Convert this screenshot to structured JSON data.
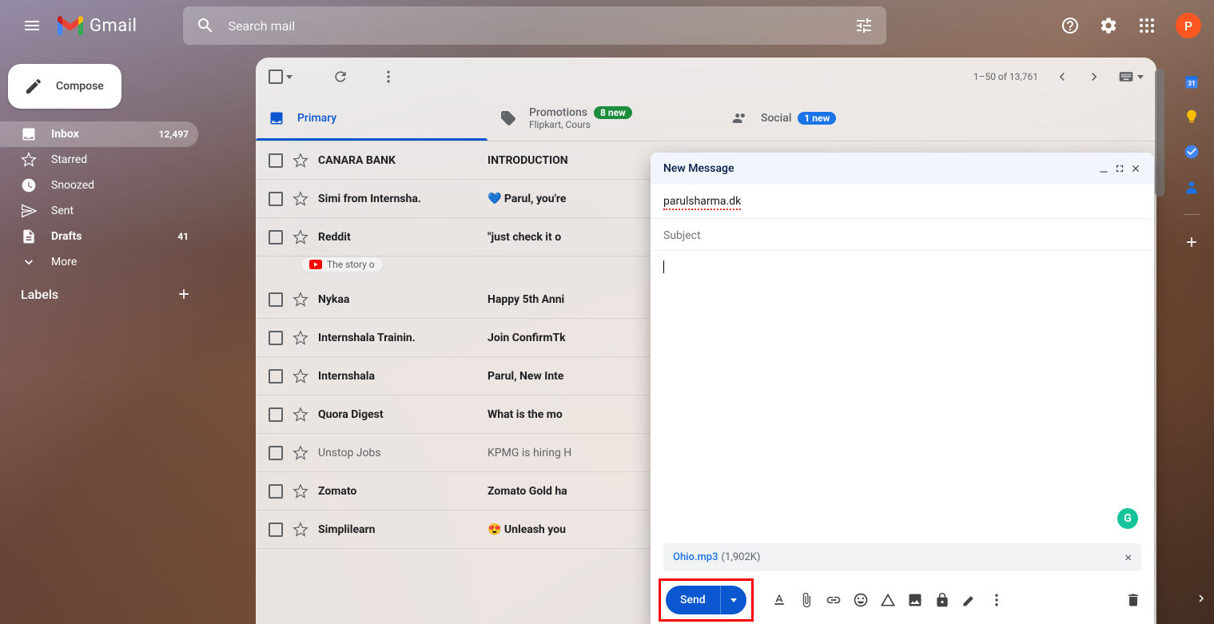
{
  "header": {
    "app_name": "Gmail",
    "search_placeholder": "Search mail",
    "avatar_letter": "P"
  },
  "sidebar": {
    "compose_label": "Compose",
    "items": [
      {
        "label": "Inbox",
        "count": "12,497",
        "active": true,
        "bold": true
      },
      {
        "label": "Starred",
        "count": "",
        "active": false,
        "bold": false
      },
      {
        "label": "Snoozed",
        "count": "",
        "active": false,
        "bold": false
      },
      {
        "label": "Sent",
        "count": "",
        "active": false,
        "bold": false
      },
      {
        "label": "Drafts",
        "count": "41",
        "active": false,
        "bold": true
      },
      {
        "label": "More",
        "count": "",
        "active": false,
        "bold": false
      }
    ],
    "labels_header": "Labels"
  },
  "toolbar": {
    "page_info": "1–50 of 13,761"
  },
  "tabs": [
    {
      "label": "Primary",
      "badge": "",
      "sub": ""
    },
    {
      "label": "Promotions",
      "badge": "8 new",
      "sub": "Flipkart, Cours"
    },
    {
      "label": "Social",
      "badge": "1 new",
      "sub": ""
    }
  ],
  "emails": [
    {
      "sender": "CANARA BANK",
      "subject": "INTRODUCTION",
      "read": false
    },
    {
      "sender": "Simi from Internsha.",
      "subject": "💙 Parul, you're",
      "read": false
    },
    {
      "sender": "Reddit",
      "subject": "\"just check it o",
      "read": false,
      "attachment": "The story o"
    },
    {
      "sender": "Nykaa",
      "subject": "Happy 5th Anni",
      "read": false
    },
    {
      "sender": "Internshala Trainin.",
      "subject": "Join ConfirmTk",
      "read": false
    },
    {
      "sender": "Internshala",
      "subject": "Parul, New Inte",
      "read": false
    },
    {
      "sender": "Quora Digest",
      "subject": "What is the mo",
      "read": false
    },
    {
      "sender": "Unstop Jobs",
      "subject": "KPMG is hiring H",
      "read": true
    },
    {
      "sender": "Zomato",
      "subject": "Zomato Gold ha",
      "read": false
    },
    {
      "sender": "Simplilearn",
      "subject": "😍 Unleash you",
      "read": false
    }
  ],
  "compose": {
    "title": "New Message",
    "to": "parulsharma.dk",
    "subject_placeholder": "Subject",
    "attachment_name": "Ohio.mp3",
    "attachment_size": "(1,902K)",
    "send_label": "Send"
  }
}
